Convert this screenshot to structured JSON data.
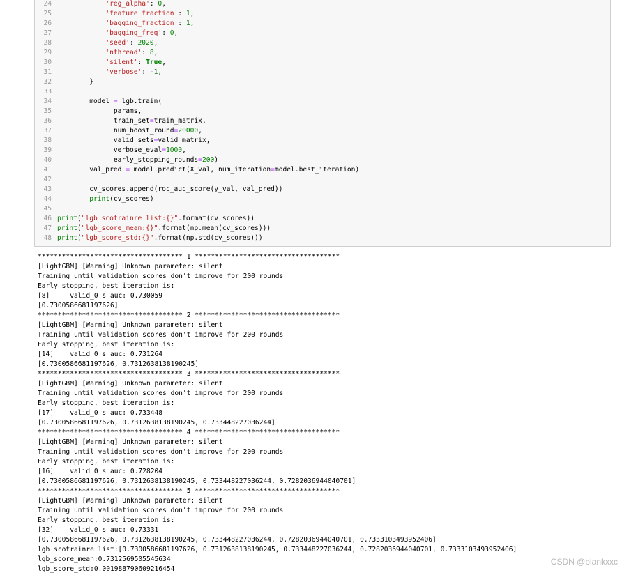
{
  "code_cell": {
    "lines": [
      {
        "num": "24",
        "parts": [
          {
            "t": "            ",
            "c": ""
          },
          {
            "t": "'reg_alpha'",
            "c": "tk-str"
          },
          {
            "t": ": ",
            "c": ""
          },
          {
            "t": "0",
            "c": "tk-num"
          },
          {
            "t": ",",
            "c": ""
          }
        ]
      },
      {
        "num": "25",
        "parts": [
          {
            "t": "            ",
            "c": ""
          },
          {
            "t": "'feature_fraction'",
            "c": "tk-str"
          },
          {
            "t": ": ",
            "c": ""
          },
          {
            "t": "1",
            "c": "tk-num"
          },
          {
            "t": ",",
            "c": ""
          }
        ]
      },
      {
        "num": "26",
        "parts": [
          {
            "t": "            ",
            "c": ""
          },
          {
            "t": "'bagging_fraction'",
            "c": "tk-str"
          },
          {
            "t": ": ",
            "c": ""
          },
          {
            "t": "1",
            "c": "tk-num"
          },
          {
            "t": ",",
            "c": ""
          }
        ]
      },
      {
        "num": "27",
        "parts": [
          {
            "t": "            ",
            "c": ""
          },
          {
            "t": "'bagging_freq'",
            "c": "tk-str"
          },
          {
            "t": ": ",
            "c": ""
          },
          {
            "t": "0",
            "c": "tk-num"
          },
          {
            "t": ",",
            "c": ""
          }
        ]
      },
      {
        "num": "28",
        "parts": [
          {
            "t": "            ",
            "c": ""
          },
          {
            "t": "'seed'",
            "c": "tk-str"
          },
          {
            "t": ": ",
            "c": ""
          },
          {
            "t": "2020",
            "c": "tk-num"
          },
          {
            "t": ",",
            "c": ""
          }
        ]
      },
      {
        "num": "29",
        "parts": [
          {
            "t": "            ",
            "c": ""
          },
          {
            "t": "'nthread'",
            "c": "tk-str"
          },
          {
            "t": ": ",
            "c": ""
          },
          {
            "t": "8",
            "c": "tk-num"
          },
          {
            "t": ",",
            "c": ""
          }
        ]
      },
      {
        "num": "30",
        "parts": [
          {
            "t": "            ",
            "c": ""
          },
          {
            "t": "'silent'",
            "c": "tk-str"
          },
          {
            "t": ": ",
            "c": ""
          },
          {
            "t": "True",
            "c": "tk-kw"
          },
          {
            "t": ",",
            "c": ""
          }
        ]
      },
      {
        "num": "31",
        "parts": [
          {
            "t": "            ",
            "c": ""
          },
          {
            "t": "'verbose'",
            "c": "tk-str"
          },
          {
            "t": ": ",
            "c": ""
          },
          {
            "t": "-",
            "c": "tk-op"
          },
          {
            "t": "1",
            "c": "tk-num"
          },
          {
            "t": ",",
            "c": ""
          }
        ]
      },
      {
        "num": "32",
        "parts": [
          {
            "t": "        }",
            "c": ""
          }
        ]
      },
      {
        "num": "33",
        "parts": [
          {
            "t": "",
            "c": ""
          }
        ]
      },
      {
        "num": "34",
        "parts": [
          {
            "t": "        model ",
            "c": ""
          },
          {
            "t": "=",
            "c": "tk-op"
          },
          {
            "t": " lgb.train(",
            "c": ""
          }
        ]
      },
      {
        "num": "35",
        "parts": [
          {
            "t": "              params,",
            "c": ""
          }
        ]
      },
      {
        "num": "36",
        "parts": [
          {
            "t": "              train_set",
            "c": ""
          },
          {
            "t": "=",
            "c": "tk-op"
          },
          {
            "t": "train_matrix,",
            "c": ""
          }
        ]
      },
      {
        "num": "37",
        "parts": [
          {
            "t": "              num_boost_round",
            "c": ""
          },
          {
            "t": "=",
            "c": "tk-op"
          },
          {
            "t": "20000",
            "c": "tk-num"
          },
          {
            "t": ",",
            "c": ""
          }
        ]
      },
      {
        "num": "38",
        "parts": [
          {
            "t": "              valid_sets",
            "c": ""
          },
          {
            "t": "=",
            "c": "tk-op"
          },
          {
            "t": "valid_matrix,",
            "c": ""
          }
        ]
      },
      {
        "num": "39",
        "parts": [
          {
            "t": "              verbose_eval",
            "c": ""
          },
          {
            "t": "=",
            "c": "tk-op"
          },
          {
            "t": "1000",
            "c": "tk-num"
          },
          {
            "t": ",",
            "c": ""
          }
        ]
      },
      {
        "num": "40",
        "parts": [
          {
            "t": "              early_stopping_rounds",
            "c": ""
          },
          {
            "t": "=",
            "c": "tk-op"
          },
          {
            "t": "200",
            "c": "tk-num"
          },
          {
            "t": ")",
            "c": ""
          }
        ]
      },
      {
        "num": "41",
        "parts": [
          {
            "t": "        val_pred ",
            "c": ""
          },
          {
            "t": "=",
            "c": "tk-op"
          },
          {
            "t": " model.predict(X_val, num_iteration",
            "c": ""
          },
          {
            "t": "=",
            "c": "tk-op"
          },
          {
            "t": "model.best_iteration)",
            "c": ""
          }
        ]
      },
      {
        "num": "42",
        "parts": [
          {
            "t": "",
            "c": ""
          }
        ]
      },
      {
        "num": "43",
        "parts": [
          {
            "t": "        cv_scores.append(roc_auc_score(y_val, val_pred))",
            "c": ""
          }
        ]
      },
      {
        "num": "44",
        "parts": [
          {
            "t": "        ",
            "c": ""
          },
          {
            "t": "print",
            "c": "tk-builtin"
          },
          {
            "t": "(cv_scores)",
            "c": ""
          }
        ]
      },
      {
        "num": "45",
        "parts": [
          {
            "t": "",
            "c": ""
          }
        ]
      },
      {
        "num": "46",
        "parts": [
          {
            "t": "print",
            "c": "tk-builtin"
          },
          {
            "t": "(",
            "c": ""
          },
          {
            "t": "\"lgb_scotrainre_list:{}\"",
            "c": "tk-str"
          },
          {
            "t": ".format(cv_scores))",
            "c": ""
          }
        ]
      },
      {
        "num": "47",
        "parts": [
          {
            "t": "print",
            "c": "tk-builtin"
          },
          {
            "t": "(",
            "c": ""
          },
          {
            "t": "\"lgb_score_mean:{}\"",
            "c": "tk-str"
          },
          {
            "t": ".format(np.mean(cv_scores)))",
            "c": ""
          }
        ]
      },
      {
        "num": "48",
        "parts": [
          {
            "t": "print",
            "c": "tk-builtin"
          },
          {
            "t": "(",
            "c": ""
          },
          {
            "t": "\"lgb_score_std:{}\"",
            "c": "tk-str"
          },
          {
            "t": ".format(np.std(cv_scores)))",
            "c": ""
          }
        ]
      }
    ]
  },
  "output": {
    "lines": [
      "************************************ 1 ************************************",
      "[LightGBM] [Warning] Unknown parameter: silent",
      "Training until validation scores don't improve for 200 rounds",
      "Early stopping, best iteration is:",
      "[8]\tvalid_0's auc: 0.730059",
      "[0.7300586681197626]",
      "************************************ 2 ************************************",
      "[LightGBM] [Warning] Unknown parameter: silent",
      "Training until validation scores don't improve for 200 rounds",
      "Early stopping, best iteration is:",
      "[14]\tvalid_0's auc: 0.731264",
      "[0.7300586681197626, 0.7312638138190245]",
      "************************************ 3 ************************************",
      "[LightGBM] [Warning] Unknown parameter: silent",
      "Training until validation scores don't improve for 200 rounds",
      "Early stopping, best iteration is:",
      "[17]\tvalid_0's auc: 0.733448",
      "[0.7300586681197626, 0.7312638138190245, 0.733448227036244]",
      "************************************ 4 ************************************",
      "[LightGBM] [Warning] Unknown parameter: silent",
      "Training until validation scores don't improve for 200 rounds",
      "Early stopping, best iteration is:",
      "[16]\tvalid_0's auc: 0.728204",
      "[0.7300586681197626, 0.7312638138190245, 0.733448227036244, 0.7282036944040701]",
      "************************************ 5 ************************************",
      "[LightGBM] [Warning] Unknown parameter: silent",
      "Training until validation scores don't improve for 200 rounds",
      "Early stopping, best iteration is:",
      "[32]\tvalid_0's auc: 0.73331",
      "[0.7300586681197626, 0.7312638138190245, 0.733448227036244, 0.7282036944040701, 0.7333103493952406]",
      "lgb_scotrainre_list:[0.7300586681197626, 0.7312638138190245, 0.733448227036244, 0.7282036944040701, 0.7333103493952406]",
      "lgb_score_mean:0.7312569505545634",
      "lgb_score_std:0.001988790609216454"
    ]
  },
  "watermark": "CSDN @blankxxc"
}
